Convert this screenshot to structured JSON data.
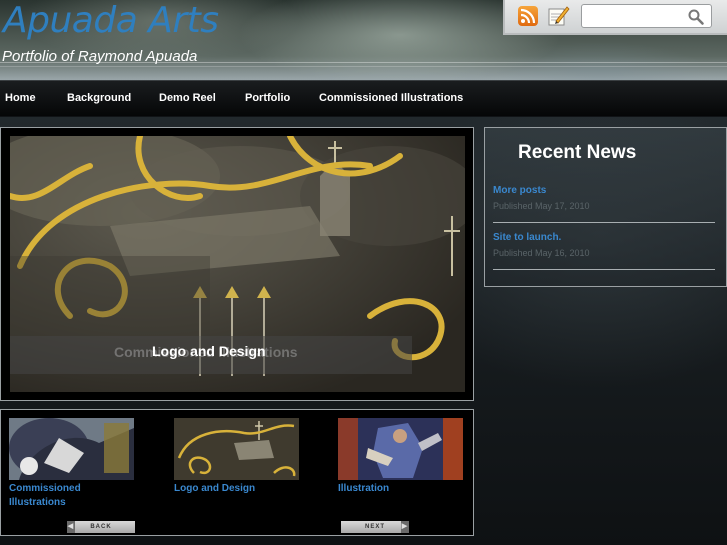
{
  "header": {
    "title": "Apuada Arts",
    "subtitle": "Portfolio of Raymond Apuada",
    "search": {
      "value": "",
      "placeholder": ""
    }
  },
  "nav": {
    "items": [
      {
        "label": "Home"
      },
      {
        "label": "Background"
      },
      {
        "label": "Demo Reel"
      },
      {
        "label": "Portfolio"
      },
      {
        "label": "Commissioned Illustrations"
      }
    ]
  },
  "featured": {
    "caption": "Logo and Design",
    "caption_behind": "Commissioned Illustrations"
  },
  "thumbnails": {
    "items": [
      {
        "label": "Commissioned Illustrations"
      },
      {
        "label": "Logo and Design"
      },
      {
        "label": "Illustration"
      }
    ],
    "back_label": "BACK",
    "next_label": "NEXT"
  },
  "sidebar": {
    "title": "Recent News",
    "posts": [
      {
        "title": "More posts",
        "date": "Published May 17, 2010"
      },
      {
        "title": "Site to launch.",
        "date": "Published May 16, 2010"
      }
    ]
  },
  "colors": {
    "link": "#3a88cf",
    "title_blue": "#2f7fbf",
    "nav_bg": "#050607"
  }
}
